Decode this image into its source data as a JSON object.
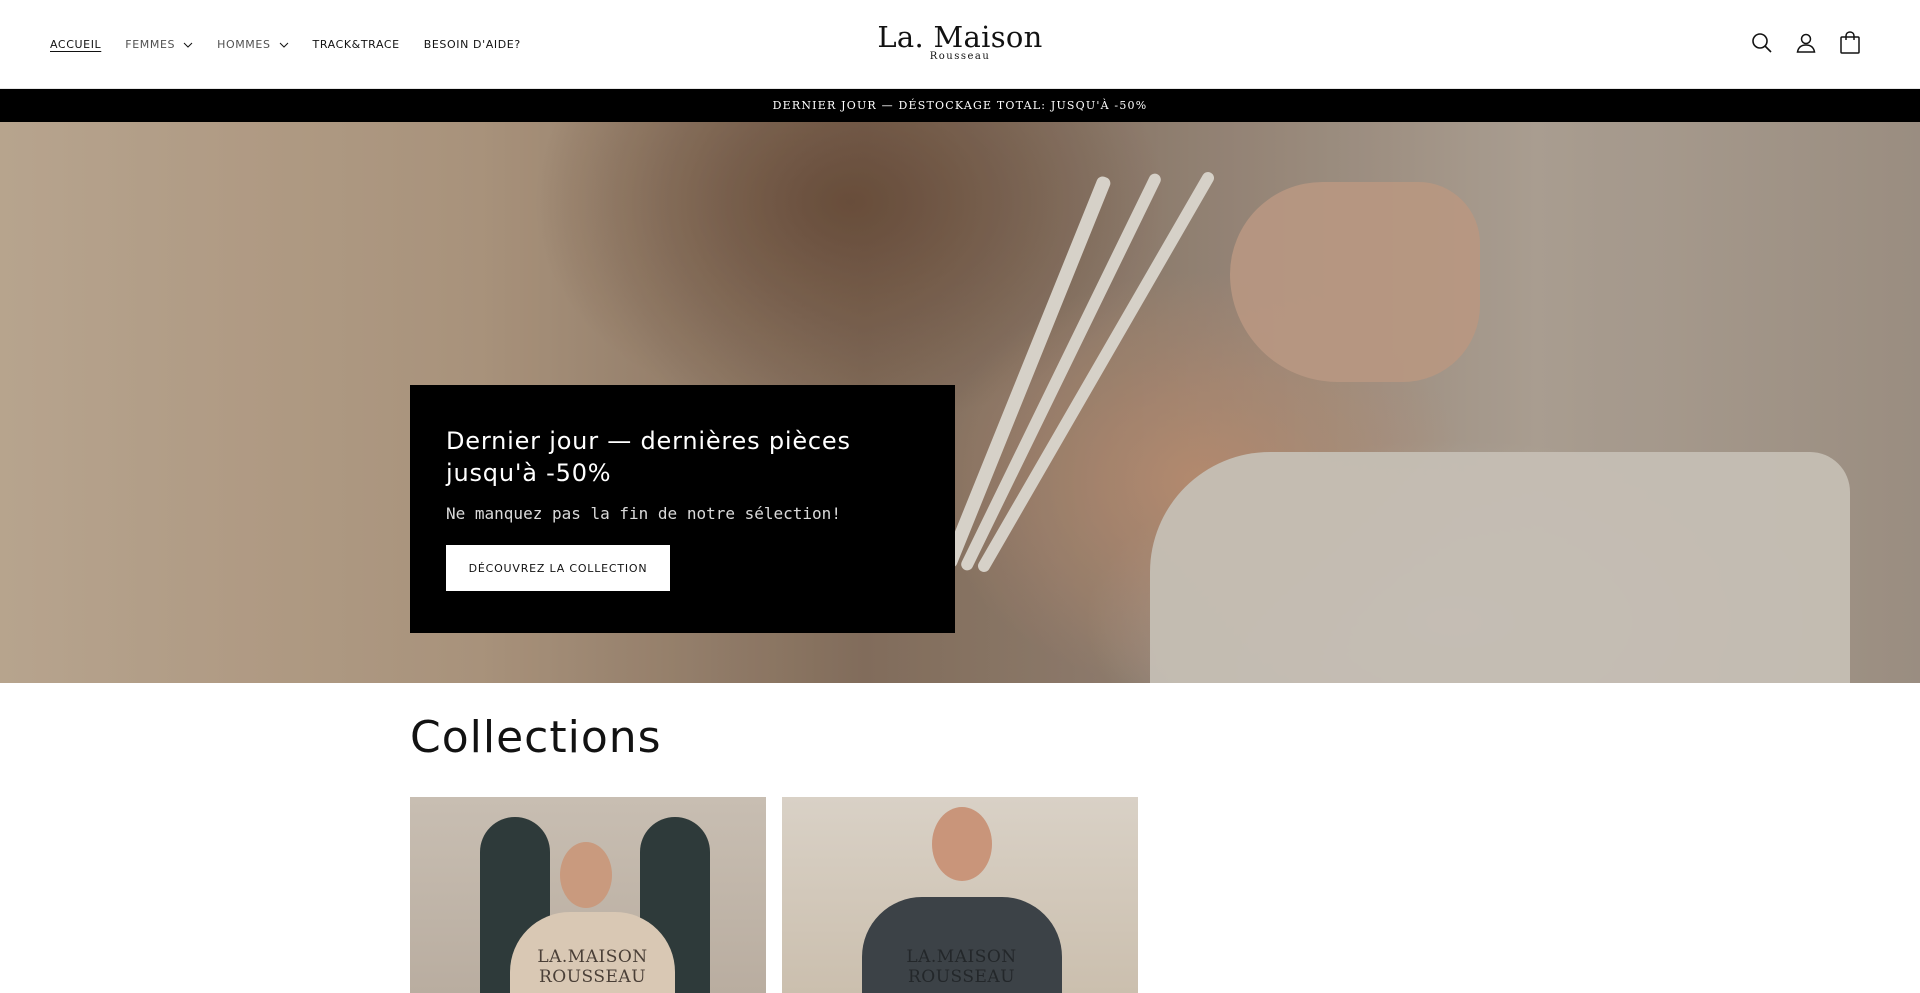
{
  "nav": {
    "items": [
      {
        "label": "ACCUEIL",
        "has_dropdown": false,
        "active": true
      },
      {
        "label": "FEMMES",
        "has_dropdown": true,
        "active": false
      },
      {
        "label": "HOMMES",
        "has_dropdown": true,
        "active": false
      },
      {
        "label": "TRACK&TRACE",
        "has_dropdown": false,
        "active": false
      },
      {
        "label": "BESOIN D'AIDE?",
        "has_dropdown": false,
        "active": false
      }
    ]
  },
  "logo": {
    "main": "La. Maison",
    "sub": "Rousseau"
  },
  "header_icons": [
    "search-icon",
    "account-icon",
    "cart-icon"
  ],
  "announcement": "DERNIER JOUR — DÉSTOCKAGE TOTAL: JUSQU'À -50%",
  "hero": {
    "title": "Dernier jour — dernières pièces jusqu'à -50%",
    "subtitle": "Ne manquez pas la fin de notre sélection!",
    "button": "DÉCOUVREZ LA COLLECTION"
  },
  "collections": {
    "title": "Collections",
    "cards": [
      {
        "print": "LA.MAISON ROUSSEAU"
      },
      {
        "print": "LA.MAISON ROUSSEAU"
      }
    ]
  },
  "colors": {
    "announcement_bg": "#000000",
    "hero_box_bg": "#000000",
    "text": "#121212"
  }
}
